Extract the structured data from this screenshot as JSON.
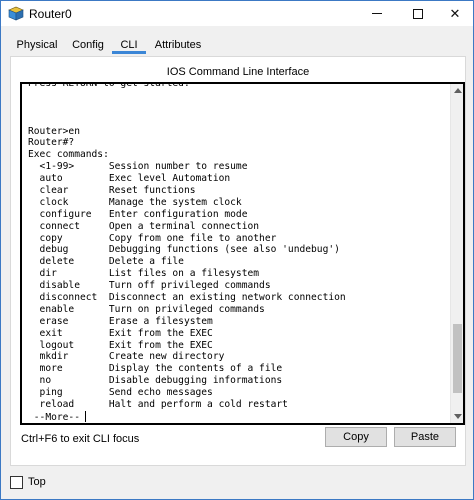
{
  "window": {
    "title": "Router0"
  },
  "tabs": [
    {
      "label": "Physical"
    },
    {
      "label": "Config"
    },
    {
      "label": "CLI"
    },
    {
      "label": "Attributes"
    }
  ],
  "active_tab": "CLI",
  "panel": {
    "title": "IOS Command Line Interface"
  },
  "terminal": {
    "lines": [
      "Press RETURN to get started.",
      "",
      "",
      "",
      "Router>en",
      "Router#?",
      "Exec commands:",
      "  <1-99>      Session number to resume",
      "  auto        Exec level Automation",
      "  clear       Reset functions",
      "  clock       Manage the system clock",
      "  configure   Enter configuration mode",
      "  connect     Open a terminal connection",
      "  copy        Copy from one file to another",
      "  debug       Debugging functions (see also 'undebug')",
      "  delete      Delete a file",
      "  dir         List files on a filesystem",
      "  disable     Turn off privileged commands",
      "  disconnect  Disconnect an existing network connection",
      "  enable      Turn on privileged commands",
      "  erase       Erase a filesystem",
      "  exit        Exit from the EXEC",
      "  logout      Exit from the EXEC",
      "  mkdir       Create new directory",
      "  more        Display the contents of a file",
      "  no          Disable debugging informations",
      "  ping        Send echo messages",
      "  reload      Halt and perform a cold restart",
      " --More--"
    ],
    "scroll_position": 0.93,
    "scroll_visible_fraction": 0.22
  },
  "footer_hint": "Ctrl+F6 to exit CLI focus",
  "buttons": {
    "copy": "Copy",
    "paste": "Paste"
  },
  "top_checkbox": {
    "label": "Top",
    "checked": false
  },
  "colors": {
    "accent": "#3b86d6",
    "window_border": "#3c79c4",
    "button_bg": "#e1e1e1"
  }
}
